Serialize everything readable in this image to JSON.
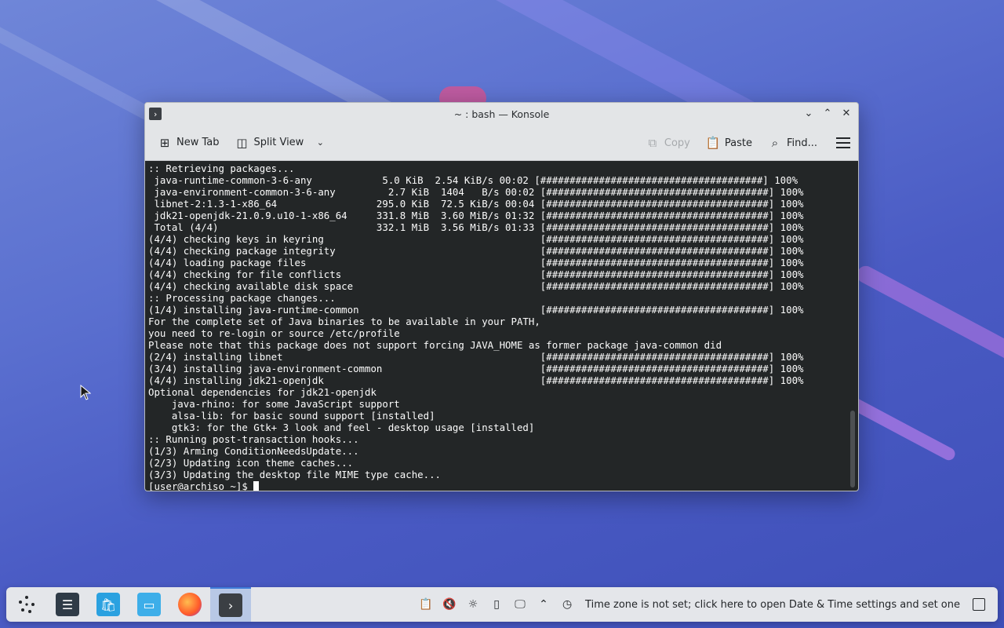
{
  "window": {
    "title": "~ : bash — Konsole",
    "app_icon": "terminal-icon",
    "controls": [
      "minimize-icon",
      "maximize-icon",
      "close-icon"
    ]
  },
  "toolbar": {
    "new_tab": "New Tab",
    "split_view": "Split View",
    "copy": "Copy",
    "paste": "Paste",
    "find": "Find..."
  },
  "terminal": {
    "lines": [
      ":: Retrieving packages...",
      " java-runtime-common-3-6-any            5.0 KiB  2.54 KiB/s 00:02 [######################################] 100%",
      " java-environment-common-3-6-any         2.7 KiB  1404   B/s 00:02 [######################################] 100%",
      " libnet-2:1.3-1-x86_64                 295.0 KiB  72.5 KiB/s 00:04 [######################################] 100%",
      " jdk21-openjdk-21.0.9.u10-1-x86_64     331.8 MiB  3.60 MiB/s 01:32 [######################################] 100%",
      " Total (4/4)                           332.1 MiB  3.56 MiB/s 01:33 [######################################] 100%",
      "(4/4) checking keys in keyring                                     [######################################] 100%",
      "(4/4) checking package integrity                                   [######################################] 100%",
      "(4/4) loading package files                                        [######################################] 100%",
      "(4/4) checking for file conflicts                                  [######################################] 100%",
      "(4/4) checking available disk space                                [######################################] 100%",
      ":: Processing package changes...",
      "(1/4) installing java-runtime-common                               [######################################] 100%",
      "For the complete set of Java binaries to be available in your PATH,",
      "you need to re-login or source /etc/profile",
      "Please note that this package does not support forcing JAVA_HOME as former package java-common did",
      "(2/4) installing libnet                                            [######################################] 100%",
      "(3/4) installing java-environment-common                           [######################################] 100%",
      "(4/4) installing jdk21-openjdk                                     [######################################] 100%",
      "Optional dependencies for jdk21-openjdk",
      "    java-rhino: for some JavaScript support",
      "    alsa-lib: for basic sound support [installed]",
      "    gtk3: for the Gtk+ 3 look and feel - desktop usage [installed]",
      ":: Running post-transaction hooks...",
      "(1/3) Arming ConditionNeedsUpdate...",
      "(2/3) Updating icon theme caches...",
      "(3/3) Updating the desktop file MIME type cache..."
    ],
    "prompt": "[user@archiso ~]$ "
  },
  "taskbar": {
    "apps": [
      {
        "name": "app-launcher-icon",
        "active": false
      },
      {
        "name": "system-settings-icon",
        "active": false
      },
      {
        "name": "discover-store-icon",
        "active": false
      },
      {
        "name": "file-manager-icon",
        "active": false
      },
      {
        "name": "firefox-icon",
        "active": false
      },
      {
        "name": "konsole-icon",
        "active": true
      }
    ],
    "tray_icons": [
      "clipboard-icon",
      "volume-muted-icon",
      "brightness-icon",
      "usb-device-icon",
      "display-icon",
      "expand-tray-icon",
      "clock-alert-icon"
    ],
    "timezone_notice": "Time zone is not set; click here to open Date & Time settings and set one",
    "accent_color": "#3d7bd9"
  }
}
